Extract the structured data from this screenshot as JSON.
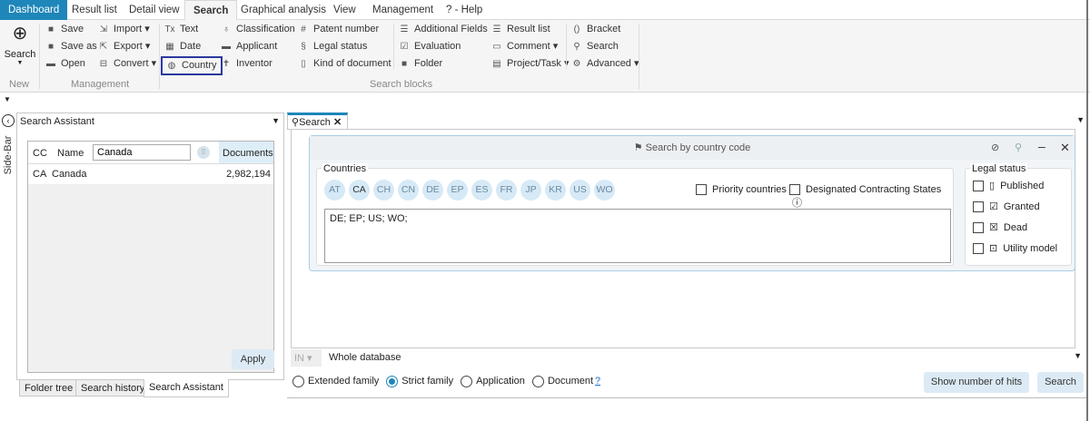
{
  "menu_tabs": [
    "Dashboard",
    "Result list",
    "Detail view",
    "Search",
    "Graphical analysis",
    "View",
    "Management",
    "? - Help"
  ],
  "ribbon": {
    "new": {
      "search_label": "Search",
      "group": "New"
    },
    "management": {
      "group": "Management",
      "items": [
        "Save",
        "Save as",
        "Open"
      ],
      "items2": [
        "Import",
        "Export",
        "Convert"
      ]
    },
    "search_blocks": {
      "group": "Search blocks",
      "col1": [
        "Text",
        "Date",
        "Country"
      ],
      "col2": [
        "Classification",
        "Applicant",
        "Inventor"
      ],
      "col3": [
        "Patent number",
        "Legal status",
        "Kind of document"
      ],
      "col4": [
        "Additional Fields",
        "Evaluation",
        "Folder"
      ],
      "col5": [
        "Result list",
        "Comment",
        "Project/Task"
      ],
      "col6": [
        "Bracket",
        "Search",
        "Advanced"
      ]
    }
  },
  "sidebar": {
    "label": "Side-Bar",
    "title": "Search Assistant",
    "grid": {
      "headers": [
        "CC",
        "Name",
        "Documents"
      ],
      "filter_value": "Canada",
      "rows": [
        {
          "cc": "CA",
          "name": "Canada",
          "documents": "2,982,194"
        }
      ]
    },
    "apply": "Apply",
    "tabs": [
      "Folder tree",
      "Search history",
      "Search Assistant"
    ]
  },
  "search_tab": {
    "label": "Search"
  },
  "dialog": {
    "title": "Search by country code",
    "countries_label": "Countries",
    "chips": [
      "AT",
      "CA",
      "CH",
      "CN",
      "DE",
      "EP",
      "ES",
      "FR",
      "JP",
      "KR",
      "US",
      "WO"
    ],
    "priority": "Priority countries",
    "designated": "Designated Contracting States",
    "input_value": "DE; EP; US; WO;",
    "legal_label": "Legal status",
    "legal": [
      "Published",
      "Granted",
      "Dead",
      "Utility model"
    ]
  },
  "scope": {
    "operator": "IN",
    "database": "Whole database"
  },
  "family": {
    "options": [
      "Extended family",
      "Strict family",
      "Application",
      "Document"
    ],
    "selected": "Strict family",
    "help": "?"
  },
  "buttons": {
    "hits": "Show number of hits",
    "search": "Search"
  }
}
